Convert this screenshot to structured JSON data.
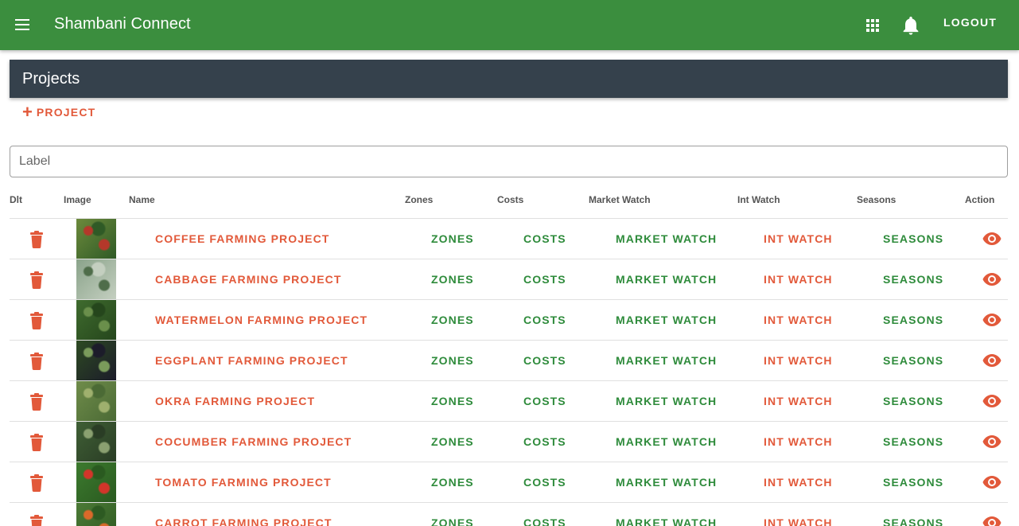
{
  "app": {
    "title": "Shambani Connect",
    "logout_label": "LOGOUT",
    "menu_icon": "menu-icon",
    "apps_icon": "apps-grid-icon",
    "notifications_icon": "bell-icon",
    "brand_color": "#3b8e3e"
  },
  "page": {
    "title": "Projects",
    "add_label": "PROJECT",
    "search_placeholder": "Label"
  },
  "table": {
    "columns": [
      "Dlt",
      "Image",
      "Name",
      "Zones",
      "Costs",
      "Market Watch",
      "Int Watch",
      "Seasons",
      "Action"
    ],
    "link_labels": {
      "zones": "ZONES",
      "costs": "COSTS",
      "market": "MARKET WATCH",
      "int": "INT WATCH",
      "seasons": "SEASONS"
    },
    "rows": [
      {
        "name": "COFFEE FARMING PROJECT",
        "image": "coffee-plant",
        "img_colors": [
          "#6c8a3c",
          "#b4382a",
          "#2f5a26"
        ]
      },
      {
        "name": "CABBAGE FARMING PROJECT",
        "image": "cabbage-field",
        "img_colors": [
          "#8aa38a",
          "#4f6d4a",
          "#c4cfc0"
        ]
      },
      {
        "name": "WATERMELON FARMING PROJECT",
        "image": "watermelon-field",
        "img_colors": [
          "#3f6b2e",
          "#6a8f4b",
          "#25461c"
        ]
      },
      {
        "name": "EGGPLANT FARMING PROJECT",
        "image": "eggplant-plant",
        "img_colors": [
          "#2d4a22",
          "#7a9b5b",
          "#1c1c2a"
        ]
      },
      {
        "name": "OKRA FARMING PROJECT",
        "image": "okra-plant",
        "img_colors": [
          "#6f8c4a",
          "#9fb06e",
          "#4b6a35"
        ]
      },
      {
        "name": "COCUMBER FARMING PROJECT",
        "image": "cucumber-plant",
        "img_colors": [
          "#3f5f35",
          "#8aa070",
          "#2a3d25"
        ]
      },
      {
        "name": "TOMATO FARMING PROJECT",
        "image": "tomato-plant",
        "img_colors": [
          "#3c7a2e",
          "#d2352a",
          "#2a5a20"
        ]
      },
      {
        "name": "CARROT FARMING PROJECT",
        "image": "carrot-harvest",
        "img_colors": [
          "#4c7a36",
          "#d9692a",
          "#2d5a22"
        ]
      }
    ]
  },
  "colors": {
    "accent_orange": "#e2593a",
    "link_green": "#2e8b3b",
    "header_dark": "#35414c"
  }
}
